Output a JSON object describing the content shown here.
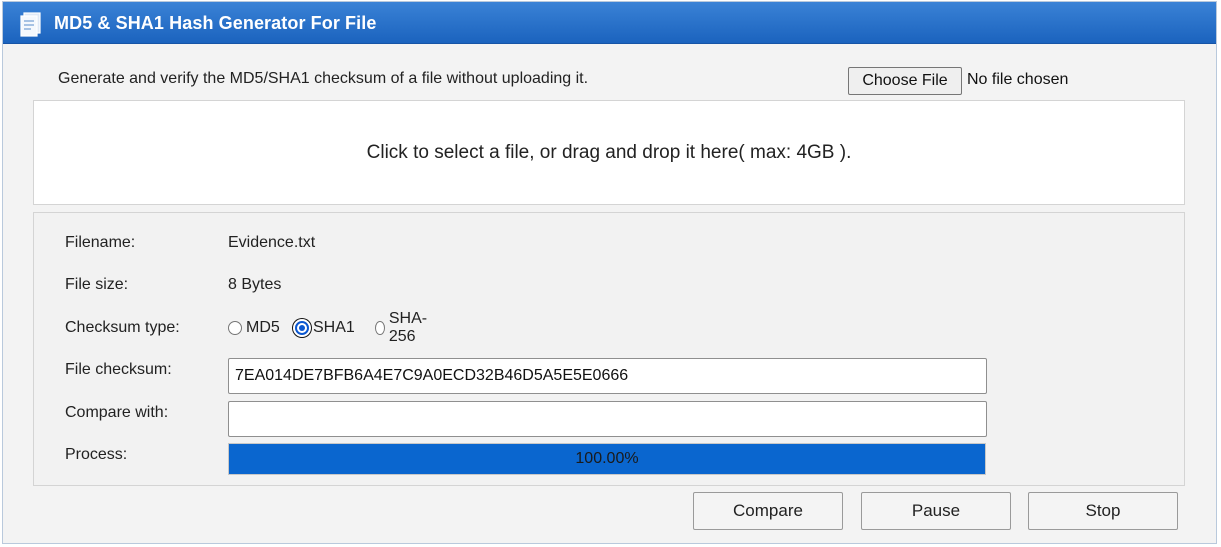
{
  "title": "MD5 & SHA1 Hash Generator For File",
  "title_icon": "document-hash-icon",
  "intro": "Generate and verify the MD5/SHA1 checksum of a file without uploading it.",
  "file_picker": {
    "button_label": "Choose File",
    "status": "No file chosen"
  },
  "dropzone": {
    "text": "Click to select a file, or drag and drop it here( max: 4GB )."
  },
  "info": {
    "filename_label": "Filename:",
    "filename_value": "Evidence.txt",
    "filesize_label": "File size:",
    "filesize_value": "8 Bytes",
    "checksum_type_label": "Checksum type:",
    "checksum_types": [
      {
        "label": "MD5",
        "checked": false
      },
      {
        "label": "SHA1",
        "checked": true
      },
      {
        "label": "SHA-256",
        "checked": false
      }
    ],
    "file_checksum_label": "File checksum:",
    "file_checksum_value": "7EA014DE7BFB6A4E7C9A0ECD32B46D5A5E5E0666",
    "compare_label": "Compare with:",
    "compare_value": "",
    "process_label": "Process:",
    "process_text": "100.00%",
    "process_fraction": 1.0
  },
  "buttons": {
    "compare": "Compare",
    "pause": "Pause",
    "stop": "Stop"
  },
  "colors": {
    "titlebar": "#1b63be",
    "progress": "#0a66cf",
    "accent": "#0b57d0"
  }
}
